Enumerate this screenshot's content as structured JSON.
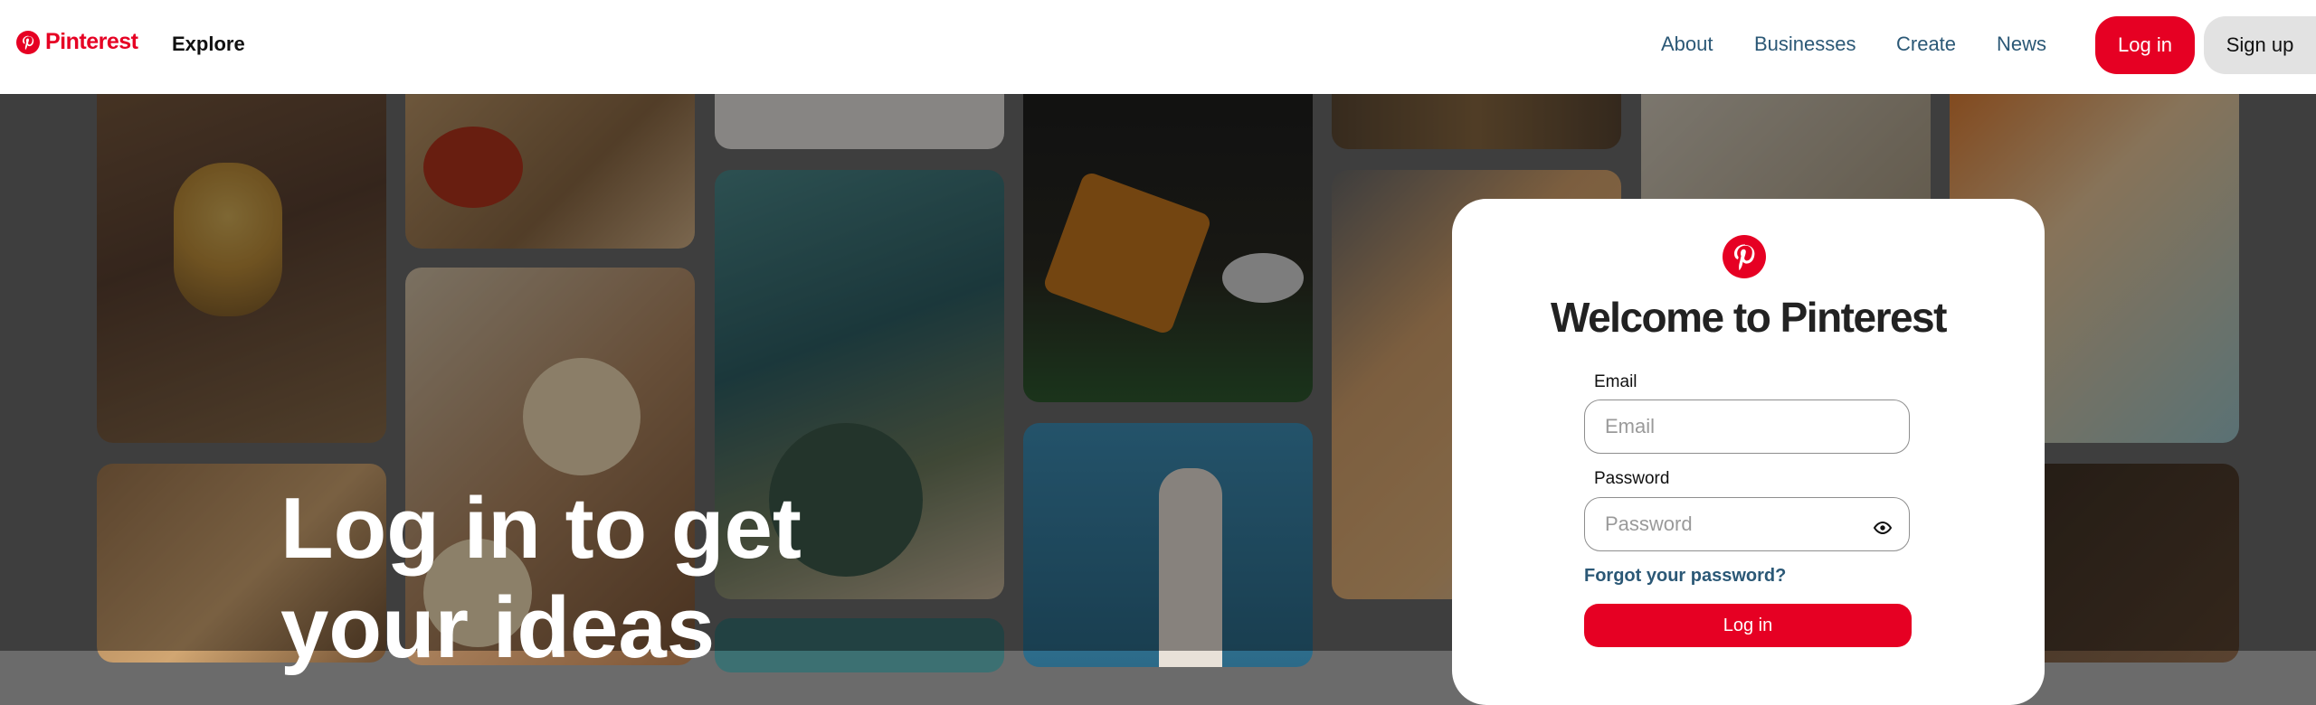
{
  "header": {
    "brand": "Pinterest",
    "explore": "Explore",
    "nav": [
      "About",
      "Businesses",
      "Create",
      "News"
    ],
    "login": "Log in",
    "signup": "Sign up"
  },
  "hero": {
    "title": "Log in to get your ideas"
  },
  "login_card": {
    "title": "Welcome to Pinterest",
    "email_label": "Email",
    "email_placeholder": "Email",
    "password_label": "Password",
    "password_placeholder": "Password",
    "forgot": "Forgot your password?",
    "submit": "Log in"
  },
  "colors": {
    "brand": "#e60023",
    "link": "#2b5876"
  }
}
